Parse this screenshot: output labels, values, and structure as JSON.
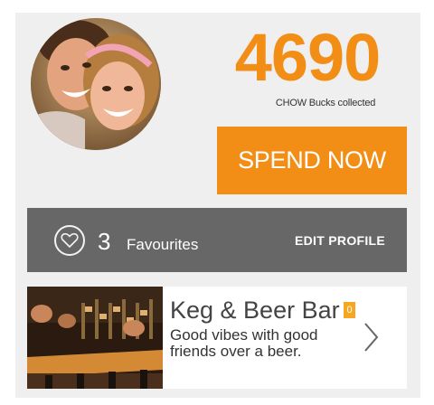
{
  "profile": {
    "avatar_icon": "user-photo-couple"
  },
  "points": {
    "value": "4690",
    "caption": "CHOW Bucks collected",
    "accent_color": "#f28e16"
  },
  "spend_button": {
    "label": "SPEND NOW"
  },
  "favourites_bar": {
    "icon": "heart-icon",
    "count": "3",
    "label": "Favourites",
    "edit_label": "EDIT PROFILE",
    "background_color": "#676767"
  },
  "venue": {
    "name": "Keg & Beer Bar",
    "badge": "0",
    "description": "Good vibes with good friends over a beer.",
    "icon": "chevron-right-icon"
  }
}
